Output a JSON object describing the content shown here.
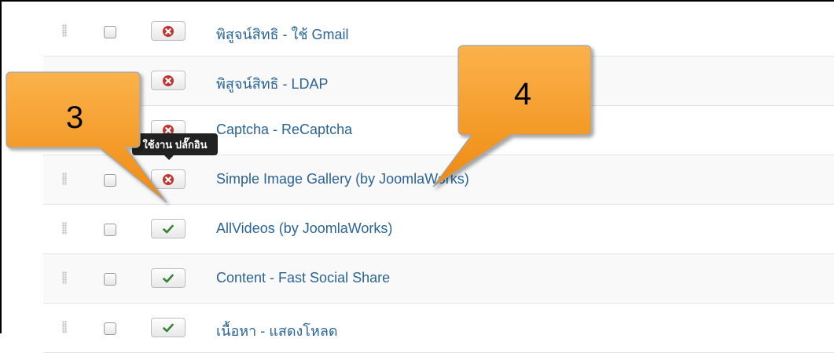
{
  "rows": [
    {
      "label": "พิสูจน์สิทธิ - ใช้ Gmail",
      "status": "disabled"
    },
    {
      "label": "พิสูจน์สิทธิ - LDAP",
      "status": "disabled"
    },
    {
      "label": "Captcha - ReCaptcha",
      "status": "disabled"
    },
    {
      "label": "Simple Image Gallery (by JoomlaWorks)",
      "status": "disabled"
    },
    {
      "label": "AllVideos (by JoomlaWorks)",
      "status": "enabled"
    },
    {
      "label": "Content - Fast Social Share",
      "status": "enabled"
    },
    {
      "label": "เนื้อหา - แสดงโหลด",
      "status": "enabled"
    }
  ],
  "tooltip": {
    "text": "ใช้งาน ปลั๊กอิน"
  },
  "callouts": [
    {
      "number": "3"
    },
    {
      "number": "4"
    }
  ],
  "colors": {
    "link": "#2a6496",
    "disabled_icon": "#bd362f",
    "enabled_icon": "#378137",
    "callout_fill": "#f59a23"
  }
}
